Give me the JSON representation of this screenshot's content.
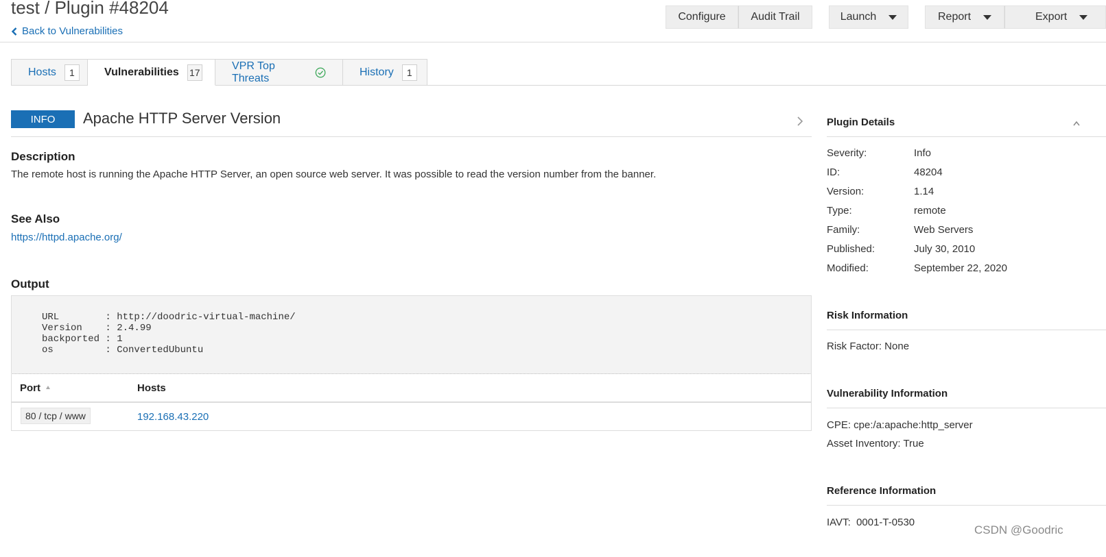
{
  "header": {
    "title": "test / Plugin #48204",
    "back_link": "Back to Vulnerabilities",
    "buttons": {
      "configure": "Configure",
      "audit_trail": "Audit Trail",
      "launch": "Launch",
      "report": "Report",
      "export": "Export"
    }
  },
  "tabs": [
    {
      "label": "Hosts",
      "count": "1",
      "active": false
    },
    {
      "label": "Vulnerabilities",
      "count": "17",
      "active": true
    },
    {
      "label": "VPR Top Threats",
      "icon": "check-circle-icon",
      "active": false
    },
    {
      "label": "History",
      "count": "1",
      "active": false
    }
  ],
  "vulnerability": {
    "severity": "INFO",
    "severity_color": "#1a6fb5",
    "title": "Apache HTTP Server Version",
    "description_heading": "Description",
    "description": "The remote host is running the Apache HTTP Server, an open source web server. It was possible to read the version number from the banner.",
    "see_also_heading": "See Also",
    "see_also_link": "https://httpd.apache.org/",
    "output_heading": "Output",
    "output": "URL        : http://doodric-virtual-machine/\nVersion    : 2.4.99\nbackported : 1\nos         : ConvertedUbuntu",
    "table": {
      "headers": {
        "port": "Port",
        "hosts": "Hosts"
      },
      "rows": [
        {
          "port": "80 / tcp / www",
          "host": "192.168.43.220"
        }
      ]
    }
  },
  "plugin_details": {
    "heading": "Plugin Details",
    "items": [
      {
        "label": "Severity:",
        "value": "Info"
      },
      {
        "label": "ID:",
        "value": "48204"
      },
      {
        "label": "Version:",
        "value": "1.14"
      },
      {
        "label": "Type:",
        "value": "remote"
      },
      {
        "label": "Family:",
        "value": "Web Servers"
      },
      {
        "label": "Published:",
        "value": "July 30, 2010"
      },
      {
        "label": "Modified:",
        "value": "September 22, 2020"
      }
    ]
  },
  "risk_information": {
    "heading": "Risk Information",
    "risk_factor": "Risk Factor: None"
  },
  "vulnerability_information": {
    "heading": "Vulnerability Information",
    "cpe": "CPE: cpe:/a:apache:http_server",
    "asset_inventory": "Asset Inventory: True"
  },
  "reference_information": {
    "heading": "Reference Information",
    "iavt": "IAVT:  0001-T-0530"
  },
  "watermark": "CSDN @Goodric",
  "colors": {
    "link": "#1a6fb5",
    "accent": "#1a6fb5",
    "success": "#3aa757"
  }
}
